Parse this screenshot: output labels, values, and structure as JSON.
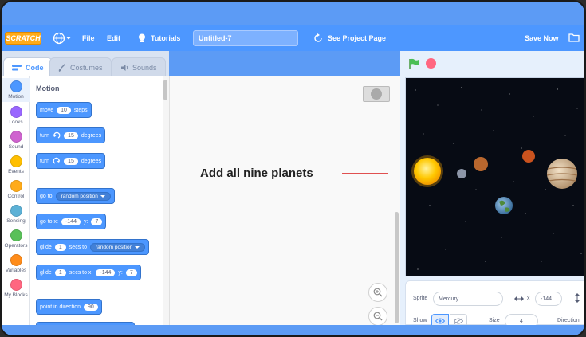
{
  "menu": {
    "logo": "SCRATCH",
    "file": "File",
    "edit": "Edit",
    "tutorials": "Tutorials",
    "project_title": "Untitled-7",
    "see_project": "See Project Page",
    "save_now": "Save Now"
  },
  "tabs": {
    "code": "Code",
    "costumes": "Costumes",
    "sounds": "Sounds"
  },
  "categories": [
    {
      "label": "Motion",
      "color": "#4c97ff"
    },
    {
      "label": "Looks",
      "color": "#9966ff"
    },
    {
      "label": "Sound",
      "color": "#cf63cf"
    },
    {
      "label": "Events",
      "color": "#ffbf00"
    },
    {
      "label": "Control",
      "color": "#ffab19"
    },
    {
      "label": "Sensing",
      "color": "#5cb1d6"
    },
    {
      "label": "Operators",
      "color": "#59c059"
    },
    {
      "label": "Variables",
      "color": "#ff8c1a"
    },
    {
      "label": "My Blocks",
      "color": "#ff6680"
    }
  ],
  "palette": {
    "title": "Motion",
    "move": {
      "pre": "move",
      "value": "10",
      "post": "steps"
    },
    "turn_right": {
      "pre": "turn",
      "value": "15",
      "post": "degrees"
    },
    "turn_left": {
      "pre": "turn",
      "value": "15",
      "post": "degrees"
    },
    "go_to": {
      "pre": "go to",
      "option": "random position"
    },
    "go_to_xy": {
      "pre": "go to x:",
      "x": "-144",
      "ylabel": "y:",
      "y": "7"
    },
    "glide_to": {
      "pre": "glide",
      "value": "1",
      "mid": "secs to",
      "option": "random position"
    },
    "glide_xy": {
      "pre": "glide",
      "value": "1",
      "mid": "secs to x:",
      "x": "-144",
      "ylabel": "y:",
      "y": "7"
    },
    "point": {
      "pre": "point in direction",
      "value": "90"
    }
  },
  "workspace": {
    "annotation": "Add all nine planets"
  },
  "sprite_info": {
    "sprite_label": "Sprite",
    "sprite_name": "Mercury",
    "x_label": "x",
    "x_value": "-144",
    "show_label": "Show",
    "size_label": "Size",
    "size_value": "4",
    "direction_label": "Direction"
  },
  "colors": {
    "menu_bar": "#4d97ff",
    "motion_block": "#4c97ff",
    "stage_bg": "#070b14"
  }
}
